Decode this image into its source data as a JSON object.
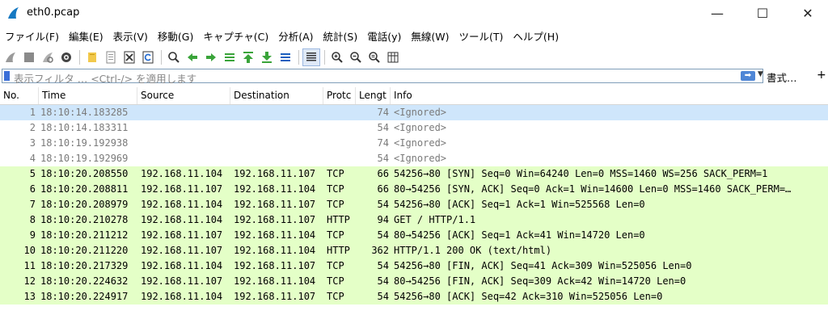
{
  "window": {
    "title": "eth0.pcap",
    "minimize_glyph": "—",
    "maximize_glyph": "☐",
    "close_glyph": "✕"
  },
  "menu": [
    "ファイル(F)",
    "編集(E)",
    "表示(V)",
    "移動(G)",
    "キャプチャ(C)",
    "分析(A)",
    "統計(S)",
    "電話(y)",
    "無線(W)",
    "ツール(T)",
    "ヘルプ(H)"
  ],
  "toolbar": {
    "icons": [
      "shark-fin-start-icon",
      "stop-icon",
      "restart-icon",
      "options-gear-icon",
      "open-folder-icon",
      "save-file-icon",
      "close-file-icon",
      "reload-icon",
      "find-icon",
      "back-arrow-icon",
      "forward-arrow-icon",
      "go-to-packet-icon",
      "first-packet-icon",
      "last-packet-icon",
      "autoscroll-icon",
      "colorize-icon",
      "zoom-in-icon",
      "zoom-out-icon",
      "normal-size-icon",
      "resize-columns-icon"
    ]
  },
  "filter": {
    "placeholder": "表示フィルタ … <Ctrl-/> を適用します",
    "expression_label": "書式…",
    "add_label": "+"
  },
  "columns": [
    "No.",
    "Time",
    "Source",
    "Destination",
    "Protc",
    "Lengt",
    "Info"
  ],
  "colors": {
    "selected_row": "#cfe6fb",
    "tcp_row": "#e4ffc7",
    "ignored_text": "#7a7a7a"
  },
  "packets": [
    {
      "no": "1",
      "time": "18:10:14.183285",
      "src": "",
      "dst": "",
      "proto": "",
      "len": "74",
      "info": "<Ignored>",
      "style": "selected"
    },
    {
      "no": "2",
      "time": "18:10:14.183311",
      "src": "",
      "dst": "",
      "proto": "",
      "len": "54",
      "info": "<Ignored>",
      "style": "ignored"
    },
    {
      "no": "3",
      "time": "18:10:19.192938",
      "src": "",
      "dst": "",
      "proto": "",
      "len": "74",
      "info": "<Ignored>",
      "style": "ignored"
    },
    {
      "no": "4",
      "time": "18:10:19.192969",
      "src": "",
      "dst": "",
      "proto": "",
      "len": "54",
      "info": "<Ignored>",
      "style": "ignored"
    },
    {
      "no": "5",
      "time": "18:10:20.208550",
      "src": "192.168.11.104",
      "dst": "192.168.11.107",
      "proto": "TCP",
      "len": "66",
      "info": "54256→80 [SYN] Seq=0 Win=64240 Len=0 MSS=1460 WS=256 SACK_PERM=1",
      "style": "tcp"
    },
    {
      "no": "6",
      "time": "18:10:20.208811",
      "src": "192.168.11.107",
      "dst": "192.168.11.104",
      "proto": "TCP",
      "len": "66",
      "info": "80→54256 [SYN, ACK] Seq=0 Ack=1 Win=14600 Len=0 MSS=1460 SACK_PERM=…",
      "style": "tcp"
    },
    {
      "no": "7",
      "time": "18:10:20.208979",
      "src": "192.168.11.104",
      "dst": "192.168.11.107",
      "proto": "TCP",
      "len": "54",
      "info": "54256→80 [ACK] Seq=1 Ack=1 Win=525568 Len=0",
      "style": "tcp"
    },
    {
      "no": "8",
      "time": "18:10:20.210278",
      "src": "192.168.11.104",
      "dst": "192.168.11.107",
      "proto": "HTTP",
      "len": "94",
      "info": "GET / HTTP/1.1",
      "style": "tcp"
    },
    {
      "no": "9",
      "time": "18:10:20.211212",
      "src": "192.168.11.107",
      "dst": "192.168.11.104",
      "proto": "TCP",
      "len": "54",
      "info": "80→54256 [ACK] Seq=1 Ack=41 Win=14720 Len=0",
      "style": "tcp"
    },
    {
      "no": "10",
      "time": "18:10:20.211220",
      "src": "192.168.11.107",
      "dst": "192.168.11.104",
      "proto": "HTTP",
      "len": "362",
      "info": "HTTP/1.1 200 OK  (text/html)",
      "style": "tcp"
    },
    {
      "no": "11",
      "time": "18:10:20.217329",
      "src": "192.168.11.104",
      "dst": "192.168.11.107",
      "proto": "TCP",
      "len": "54",
      "info": "54256→80 [FIN, ACK] Seq=41 Ack=309 Win=525056 Len=0",
      "style": "tcp"
    },
    {
      "no": "12",
      "time": "18:10:20.224632",
      "src": "192.168.11.107",
      "dst": "192.168.11.104",
      "proto": "TCP",
      "len": "54",
      "info": "80→54256 [FIN, ACK] Seq=309 Ack=42 Win=14720 Len=0",
      "style": "tcp"
    },
    {
      "no": "13",
      "time": "18:10:20.224917",
      "src": "192.168.11.104",
      "dst": "192.168.11.107",
      "proto": "TCP",
      "len": "54",
      "info": "54256→80 [ACK] Seq=42 Ack=310 Win=525056 Len=0",
      "style": "tcp"
    }
  ]
}
